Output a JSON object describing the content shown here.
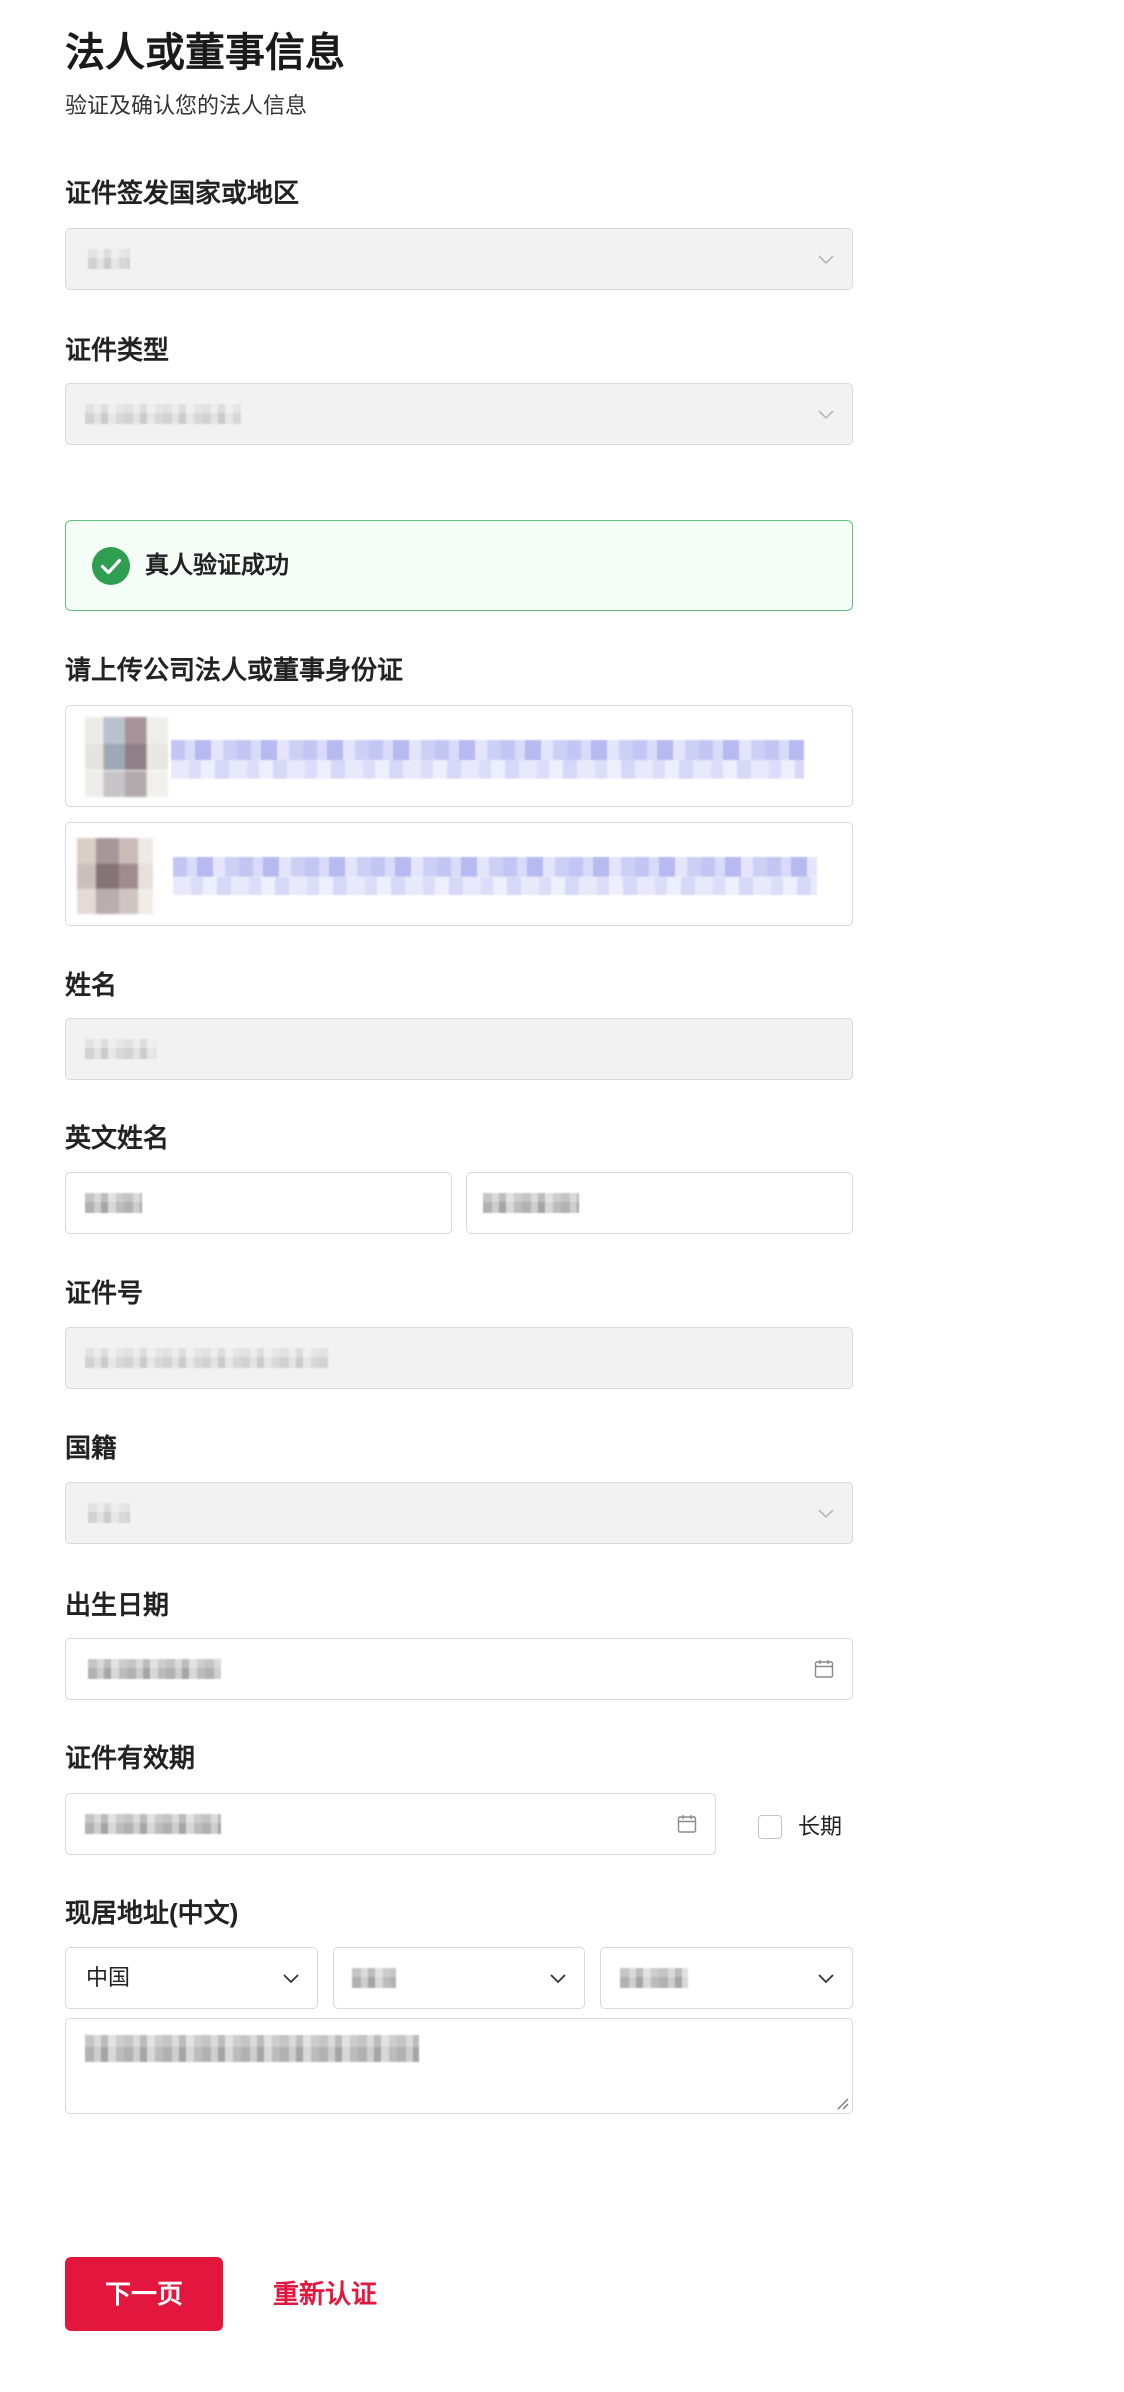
{
  "header": {
    "title": "法人或董事信息",
    "subtitle": "验证及确认您的法人信息"
  },
  "form": {
    "issuing_region": {
      "label": "证件签发国家或地区",
      "disabled": true,
      "icon": "chevron-down-icon"
    },
    "id_type": {
      "label": "证件类型",
      "disabled": true,
      "icon": "chevron-down-icon"
    },
    "verification": {
      "status_text": "真人验证成功",
      "icon": "check-circle-icon"
    },
    "id_upload": {
      "label": "请上传公司法人或董事身份证"
    },
    "name": {
      "label": "姓名",
      "disabled": true
    },
    "english_name": {
      "label": "英文姓名"
    },
    "id_number": {
      "label": "证件号",
      "disabled": true
    },
    "nationality": {
      "label": "国籍",
      "disabled": true,
      "icon": "chevron-down-icon"
    },
    "birth_date": {
      "label": "出生日期",
      "icon": "calendar-icon"
    },
    "id_validity": {
      "label": "证件有效期",
      "icon": "calendar-icon",
      "long_term_label": "长期",
      "long_term_checked": false
    },
    "address": {
      "label": "现居地址(中文)",
      "country": "中国",
      "icon": "chevron-down-icon"
    }
  },
  "actions": {
    "next_label": "下一页",
    "reverify_label": "重新认证"
  },
  "colors": {
    "accent": "#e3173d",
    "success": "#2f9e50",
    "success_border": "#63c17f",
    "success_bg": "#f4fdf6",
    "disabled_bg": "#f2f2f2",
    "border": "#d9d9d9"
  }
}
